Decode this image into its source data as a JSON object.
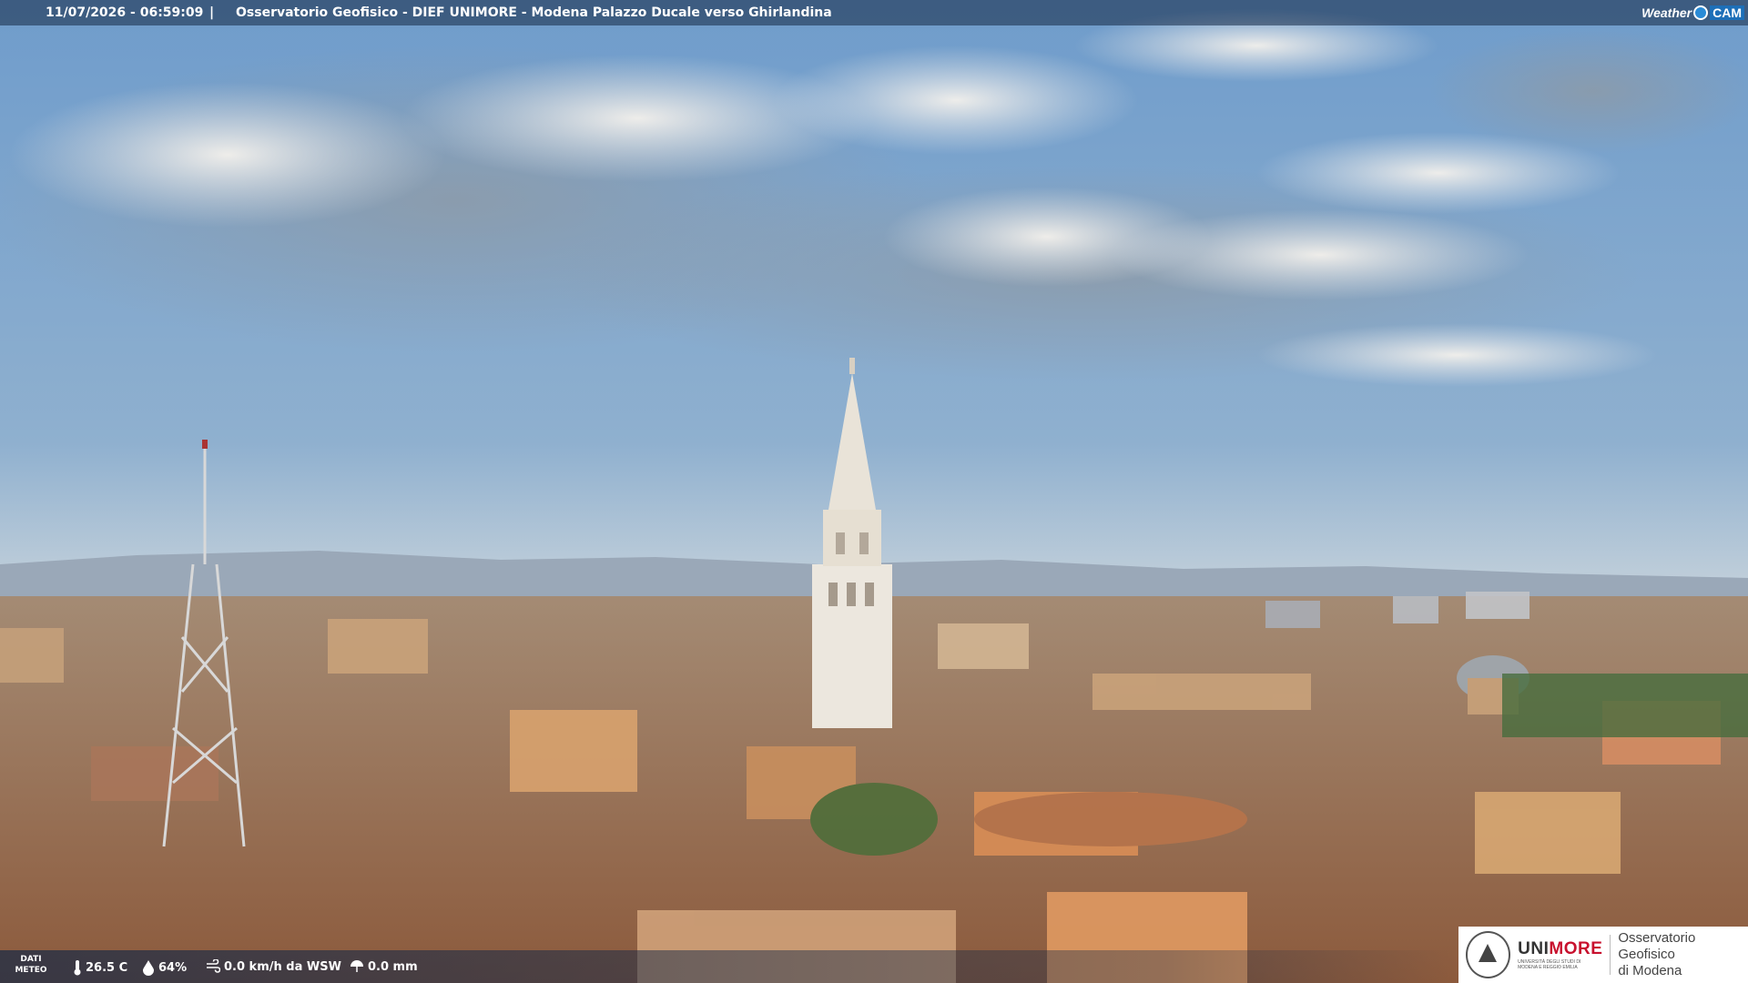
{
  "overlay": {
    "datetime": "11/07/2026 - 06:59:09",
    "separator": "|",
    "title": "Osservatorio Geofisico - DIEF UNIMORE - Modena Palazzo Ducale verso Ghirlandina"
  },
  "brand": {
    "weather": "Weather",
    "cam": "CAM"
  },
  "meteo": {
    "label_line1": "DATI",
    "label_line2": "METEO",
    "temperature": "26.5 C",
    "humidity": "64%",
    "wind": "0.0 km/h da WSW",
    "rain": "0.0 mm"
  },
  "logo": {
    "uni_prefix": "UNI",
    "uni_suffix": "MORE",
    "uni_sub": "UNIVERSITÀ DEGLI STUDI DI MODENA E REGGIO EMILIA",
    "org_line1": "Osservatorio Geofisico",
    "org_line2": "di Modena"
  },
  "colors": {
    "sky_top": "#6f9ccb",
    "sky_bottom": "#c9d4dc",
    "roof": "#b5734c",
    "tower": "#ece7de",
    "logo_red": "#c8112e"
  }
}
